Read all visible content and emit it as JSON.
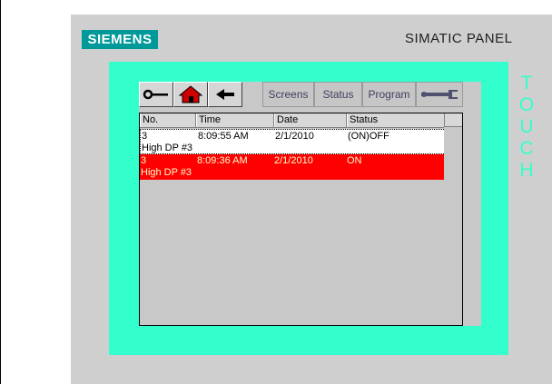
{
  "panel": {
    "brand": "SIEMENS",
    "model": "SIMATIC PANEL",
    "touch_label": "TOUCH"
  },
  "toolbar": {
    "buttons": [
      {
        "icon": "key-icon"
      },
      {
        "icon": "home-icon"
      },
      {
        "icon": "back-arrow-icon"
      },
      {
        "label": "Screens"
      },
      {
        "label": "Status"
      },
      {
        "label": "Program"
      },
      {
        "icon": "wrench-icon"
      }
    ]
  },
  "alarm_table": {
    "columns": [
      "No.",
      "Time",
      "Date",
      "Status"
    ],
    "rows": [
      {
        "no": "3",
        "time": "8:09:55 AM",
        "date": "2/1/2010",
        "status": "(ON)OFF",
        "text": "High DP #3"
      },
      {
        "no": "3",
        "time": "8:09:36 AM",
        "date": "2/1/2010",
        "status": "ON",
        "text": "High DP #3"
      }
    ]
  },
  "colors": {
    "bezel": "#33ffcc",
    "brand_bg": "#009999",
    "active_alarm": "#ff0000",
    "active_alarm_text": "#ffffcc",
    "home_icon": "#cc0000"
  }
}
